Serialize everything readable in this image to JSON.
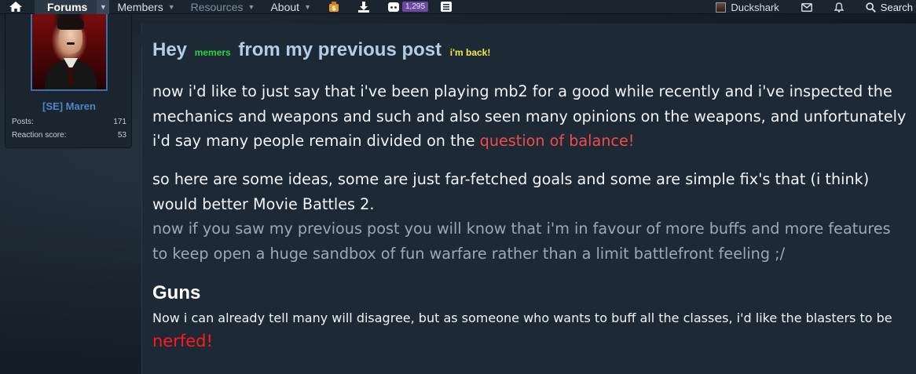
{
  "nav": {
    "tabs": [
      {
        "label": "Forums"
      },
      {
        "label": "Members"
      },
      {
        "label": "Resources"
      },
      {
        "label": "About"
      }
    ],
    "chat_badge": "1,295",
    "username": "Duckshark",
    "search_label": "Search"
  },
  "user_card": {
    "name": "[SE] Maren",
    "posts_label": "Posts:",
    "posts_value": "171",
    "reaction_label": "Reaction score:",
    "reaction_value": "53"
  },
  "post": {
    "title_hey": "Hey",
    "title_memers": "memers",
    "title_main": "from my previous post",
    "title_back": "i'm back!",
    "p1_text": "now i'd like to just say that i've been playing mb2 for a good while recently and i've inspected the mechanics and weapons and such and also seen many opinions on the weapons, and unfortunately i'd say many people remain divided on the ",
    "p1_red": "question of balance!",
    "p2_text": "so here are some ideas, some are just far-fetched goals and some are simple fix's that (i think) would better Movie Battles 2.",
    "p3_text": "now if you saw my previous post you will know that i'm in favour of more buffs and more features to keep open a huge sandbox of fun warfare rather than a limit battlefront feeling ;/",
    "guns_heading": "Guns",
    "guns_text": "Now i can already tell many will disagree, but as someone who wants to buff all the classes, i'd like the blasters to be",
    "nerfed": "nerfed!"
  },
  "colors": {
    "accent_blue": "#4c86c6",
    "red_text": "#f24b4b",
    "bright_red": "#ff1a1a",
    "green_small": "#27d53a",
    "yellow_small": "#f4e84a"
  }
}
